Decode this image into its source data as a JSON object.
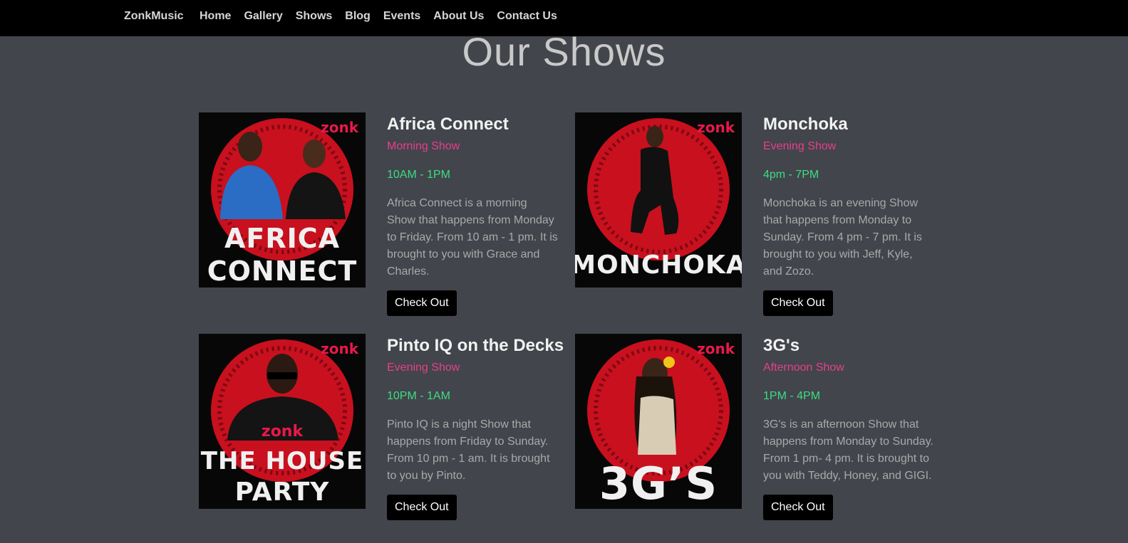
{
  "nav": {
    "brand": "ZonkMusic",
    "links": [
      "Home",
      "Gallery",
      "Shows",
      "Blog",
      "Events",
      "About Us",
      "Contact Us"
    ]
  },
  "page_title": "Our Shows",
  "shows": [
    {
      "title": "Africa Connect",
      "type": "Morning Show",
      "time": "10AM - 1PM",
      "description": "Africa Connect is a morning Show that happens from Monday to Friday. From 10 am - 1 pm. It is brought to you with Grace and Charles.",
      "button": "Check Out",
      "poster_lines": [
        "AFRICA",
        "CONNECT"
      ],
      "poster_logo": "zonk"
    },
    {
      "title": "Monchoka",
      "type": "Evening Show",
      "time": "4pm - 7PM",
      "description": "Monchoka is an evening Show that happens from Monday to Sunday. From 4 pm - 7 pm. It is brought to you with Jeff, Kyle, and Zozo.",
      "button": "Check Out",
      "poster_lines": [
        "MONCHOKA"
      ],
      "poster_logo": "zonk"
    },
    {
      "title": "Pinto IQ on the Decks",
      "type": "Evening Show",
      "time": "10PM - 1AM",
      "description": "Pinto IQ is a night Show that happens from Friday to Sunday. From 10 pm - 1 am. It is brought to you by Pinto.",
      "button": "Check Out",
      "poster_lines": [
        "THE HOUSE",
        "PARTY"
      ],
      "poster_logo": "zonk"
    },
    {
      "title": "3G's",
      "type": "Afternoon Show",
      "time": "1PM - 4PM",
      "description": "3G's is an afternoon Show that happens from Monday to Sunday. From 1 pm- 4 pm. It is brought to you with Teddy, Honey, and GIGI.",
      "button": "Check Out",
      "poster_lines": [
        "3G’S"
      ],
      "poster_logo": "zonk"
    }
  ],
  "colors": {
    "background": "#42454b",
    "navbar": "#000000",
    "accent_pink": "#e83e8c",
    "accent_green": "#3ddc84",
    "poster_red": "#c8101e"
  }
}
